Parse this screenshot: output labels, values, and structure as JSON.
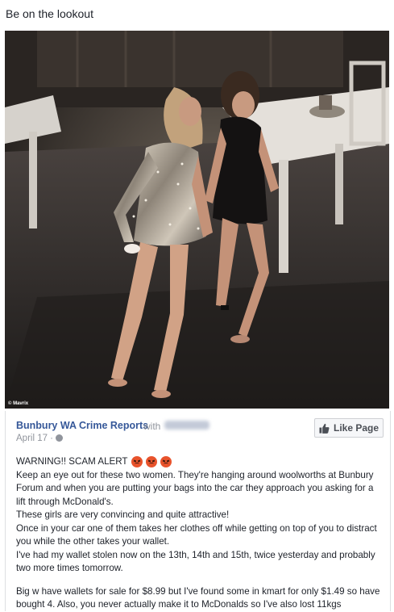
{
  "caption": "Be on the lookout",
  "photo": {
    "watermark": "© Mavrix"
  },
  "post": {
    "page_name": "Bunbury WA Crime Reports",
    "with_text": "with",
    "date": "April 17 ·",
    "like_button": "Like Page",
    "alert_title": "WARNING!! SCAM ALERT",
    "paragraphs": [
      "Keep an eye out for these two women. They're hanging around woolworths at Bunbury Forum and when you are putting your bags into the car they approach you asking for a lift through McDonald's.",
      "These girls are very convincing and quite attractive!",
      "Once in your car one of them takes her clothes off while getting on top of you to distract you while the other takes your wallet.",
      "I've had my wallet stolen now on the 13th, 14th and 15th, twice yesterday and probably two more times tomorrow."
    ],
    "footer": "Big w have wallets for sale for $8.99 but I've found some in kmart for only $1.49 so have bought 4. Also, you never actually make it to McDonalds so I've also lost 11kgs"
  },
  "icons": [
    "angry-face-icon",
    "globe-icon",
    "thumbs-up-icon"
  ],
  "colors": {
    "link": "#365899",
    "meta": "#90949c",
    "emoji": "#e8532c"
  }
}
